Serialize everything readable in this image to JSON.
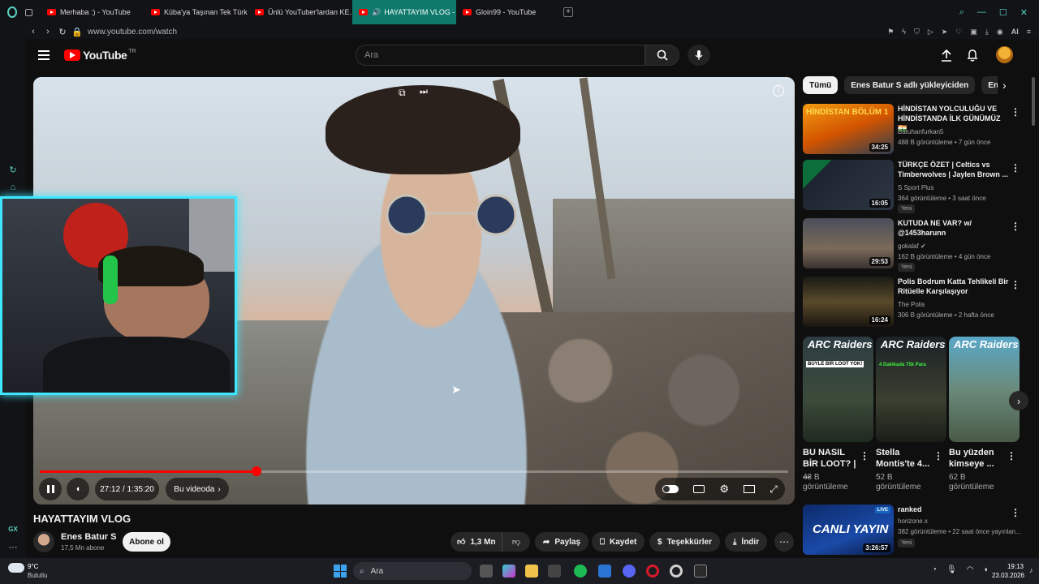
{
  "browser": {
    "tabs": [
      {
        "label": "Merhaba :) - YouTube"
      },
      {
        "label": "Küba'ya Taşınan Tek Türk"
      },
      {
        "label": "Ünlü YouTuber'lardan KE..."
      },
      {
        "label": "HAYATTAYIM VLOG -"
      },
      {
        "label": "Gloin99 - YouTube"
      }
    ],
    "url": "www.youtube.com/watch",
    "ai_label": "AI"
  },
  "youtube": {
    "logo_text": "YouTube",
    "region": "TR",
    "search_placeholder": "Ara"
  },
  "player": {
    "time": "27:12 / 1:35:20",
    "chapter": "Bu videoda",
    "progress_fraction": 0.29
  },
  "video": {
    "title": "HAYATTAYIM VLOG",
    "channel": "Enes Batur S",
    "subscribers": "17,5 Mn abone",
    "subscribe_label": "Abone ol",
    "likes": "1,3 Mn",
    "share": "Paylaş",
    "save": "Kaydet",
    "thanks": "Teşekkürler",
    "download": "İndir"
  },
  "chips": [
    "Tümü",
    "Enes Batur S adlı yükleyiciden",
    "Enes Ba"
  ],
  "recommendations": [
    {
      "title": "HİNDİSTAN YOLCULUĞU VE HİNDİSTANDA İLK GÜNÜMÜZ 🇮🇳",
      "channel": "Batuhanfurkan5",
      "meta": "488 B görüntüleme • 7 gün önce",
      "duration": "34:25",
      "badge": "",
      "thumb_text": "HİNDİSTAN BÖLÜM 1"
    },
    {
      "title": "TÜRKÇE ÖZET | Celtics vs Timberwolves | Jaylen Brown ...",
      "channel": "S Sport Plus",
      "meta": "364 görüntüleme • 3 saat önce",
      "duration": "16:05",
      "badge": "Yeni",
      "thumb_text": ""
    },
    {
      "title": "KUTUDA NE VAR? w/ @1453harunn",
      "channel": "gokalaf",
      "meta": "162 B görüntüleme • 4 gün önce",
      "duration": "29:53",
      "badge": "Yeni",
      "thumb_text": ""
    },
    {
      "title": "Polis Bodrum Katta Tehlikeli Bir Ritüelle Karşılaşıyor",
      "channel": "The Polis",
      "meta": "306 B görüntüleme • 2 hafta önce",
      "duration": "16:24",
      "badge": "",
      "thumb_text": ""
    }
  ],
  "shorts": [
    {
      "title": "BU NASIL BİR LOOT? | ...",
      "views": "48 B görüntüleme",
      "brand": "ARC Raiders",
      "overlay": "BÜYLE BİR LOOT YOK!"
    },
    {
      "title": "Stella Montis'te 4...",
      "views": "52 B görüntüleme",
      "brand": "ARC Raiders",
      "overlay": "4 Dakikada 75k Para"
    },
    {
      "title": "Bu yüzden kimseye ...",
      "views": "62 B görüntüleme",
      "brand": "ARC Raiders",
      "overlay": ""
    }
  ],
  "live": {
    "title": "ranked",
    "channel": "horizone.x",
    "meta": "382 görüntüleme • 22 saat önce yayınlan...",
    "duration": "3:26:57",
    "badge": "Yeni",
    "live_badge": "LIVE",
    "thumb_text": "CANLI YAYIN"
  },
  "taskbar": {
    "weather_temp": "9°C",
    "weather_desc": "Bulutlu",
    "search": "Ara",
    "time": "19:13",
    "date": "23.03.2026"
  },
  "colors": {
    "accent": "#ff0000",
    "opera_tab": "#0f7a6b",
    "webcam_border": "#3ee7ff"
  }
}
